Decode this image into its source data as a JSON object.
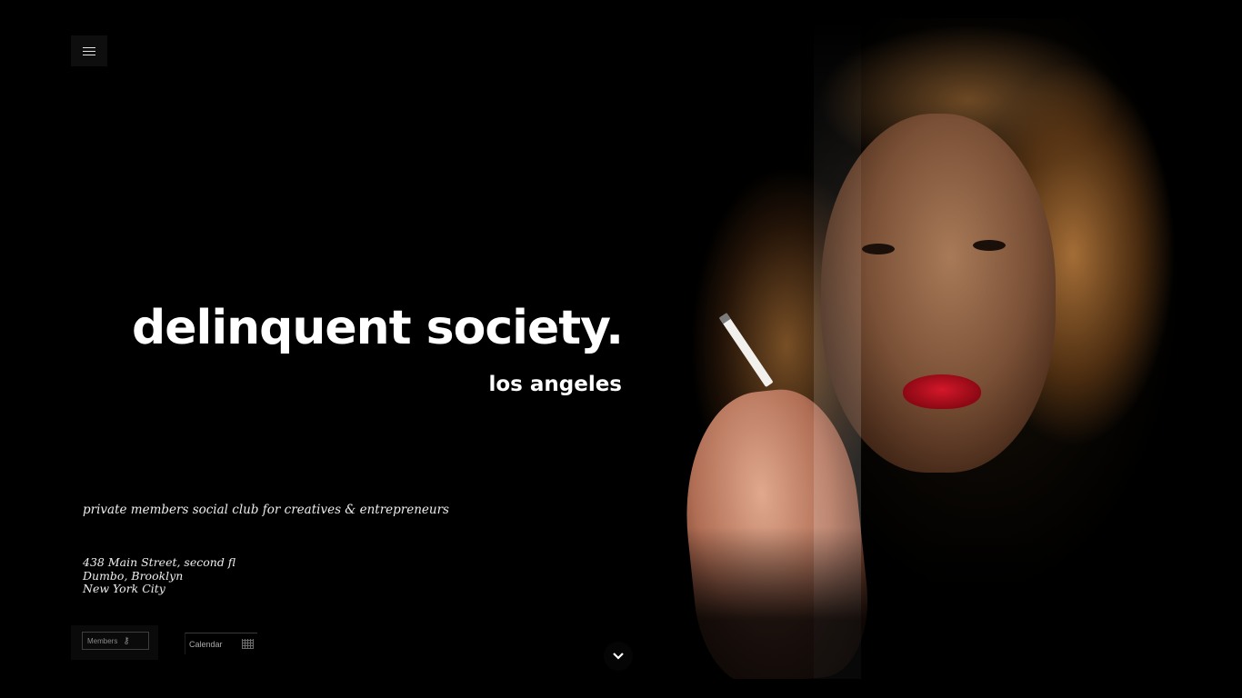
{
  "header": {
    "menu_icon": "hamburger-icon"
  },
  "hero": {
    "title": "delinquent society.",
    "subtitle": "los angeles",
    "tagline": "private members social club for creatives & entrepreneurs"
  },
  "address": {
    "lines": [
      "438 Main Street, second fl",
      "Dumbo, Brooklyn",
      "New York City"
    ]
  },
  "footer": {
    "members_label": "Members",
    "members_icon": "key-icon",
    "calendar_label": "Calendar",
    "calendar_icon": "calendar-grid-icon",
    "scroll_icon": "chevron-down-icon"
  },
  "colors": {
    "background": "#000000",
    "text": "#ffffff",
    "lips": "#c8102e"
  }
}
